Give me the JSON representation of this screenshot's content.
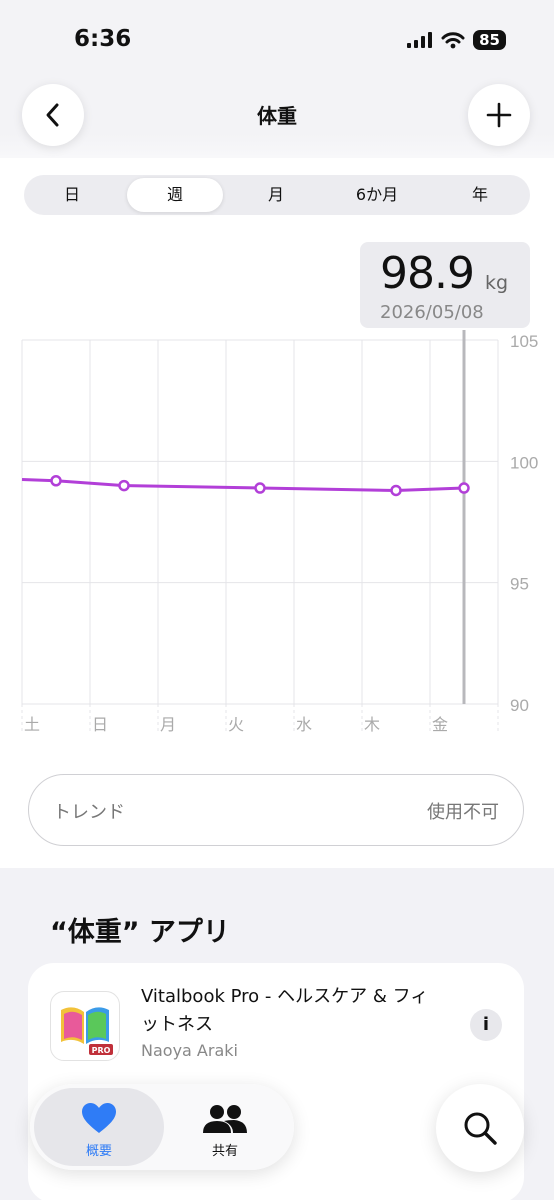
{
  "status": {
    "time": "6:36",
    "battery": "85"
  },
  "header": {
    "title": "体重",
    "back_icon": "chevron-left-icon",
    "add_icon": "plus-icon"
  },
  "segments": [
    {
      "label": "日",
      "selected": false
    },
    {
      "label": "週",
      "selected": true
    },
    {
      "label": "月",
      "selected": false
    },
    {
      "label": "6か月",
      "selected": false
    },
    {
      "label": "年",
      "selected": false
    }
  ],
  "readout": {
    "value": "98.9",
    "unit": "kg",
    "date": "2026/05/08"
  },
  "chart_data": {
    "type": "line",
    "title": "",
    "xlabel": "",
    "ylabel": "",
    "categories": [
      "土",
      "日",
      "月",
      "火",
      "水",
      "木",
      "金"
    ],
    "ytick_labels": [
      "105",
      "100",
      "95",
      "90"
    ],
    "ylim": [
      90,
      105
    ],
    "grid": true,
    "series": [
      {
        "color": "#b23fd8",
        "x": [
          0.5,
          1.5,
          3.5,
          5.5,
          6.5
        ],
        "values": [
          99.2,
          99.0,
          98.9,
          98.8,
          98.9
        ]
      }
    ],
    "selected_x": 6.5
  },
  "trend": {
    "label": "トレンド",
    "value": "使用不可"
  },
  "apps_section": {
    "title": "“体重” アプリ",
    "app": {
      "name": "Vitalbook Pro - ヘルスケア & フィットネス",
      "developer": "Naoya Araki",
      "badge": "PRO"
    }
  },
  "tabbar": {
    "tabs": [
      {
        "label": "概要",
        "icon": "heart-icon",
        "active": true
      },
      {
        "label": "共有",
        "icon": "people-icon",
        "active": false
      }
    ],
    "search_icon": "search-icon"
  },
  "colors": {
    "accent": "#2f7cf6",
    "series": "#b23fd8"
  }
}
